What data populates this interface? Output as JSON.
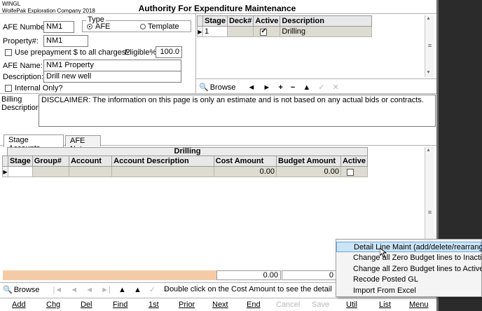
{
  "company": {
    "code": "WINGL",
    "name": "WolfePak Exploration Company 2018"
  },
  "window": {
    "title": "Authority For Expenditure Maintenance"
  },
  "form": {
    "afe_number_label": "AFE Number:",
    "afe_number": "NM1",
    "type_label": "Type",
    "type_afe": "AFE",
    "type_template": "Template",
    "type_selected": "AFE",
    "property_label": "Property#:",
    "property": "NM1",
    "prepayment_label": "Use prepayment $ to all charges?",
    "eligible_label": "Eligible%:",
    "eligible": "100.0",
    "afe_name_label": "AFE Name:",
    "afe_name": "NM1 Property",
    "description_label": "Description:",
    "description": "Drill new well",
    "internal_only_label": "Internal Only?",
    "billing_label_1": "Billing",
    "billing_label_2": "Description:",
    "billing_text": "DISCLAIMER:  The information on this page is only an estimate and is not based on any actual bids or contracts."
  },
  "stage_grid": {
    "columns": [
      "Stage",
      "Deck#",
      "Active",
      "Description"
    ],
    "rows": [
      {
        "stage": "1",
        "deck": "",
        "active": true,
        "description": "Drilling"
      }
    ]
  },
  "stage_nav": {
    "browse": "Browse",
    "icons": [
      "◄",
      "►",
      "+",
      "−",
      "▲",
      "✓",
      "✕"
    ]
  },
  "tabs": [
    {
      "label": "Stage Accounts",
      "active": true
    },
    {
      "label": "AFE Notes",
      "active": false
    }
  ],
  "accounts_grid": {
    "group_header": "Drilling",
    "columns": [
      "Stage",
      "Group#",
      "Account",
      "Account Description",
      "Cost Amount",
      "Budget Amount",
      "Active"
    ],
    "rows": [
      {
        "stage": "",
        "group": "",
        "account": "",
        "account_description": "",
        "cost_amount": "0.00",
        "budget_amount": "0.00",
        "active": false
      }
    ]
  },
  "totals": {
    "cost": "0.00",
    "budget": "0"
  },
  "bottom_nav": {
    "browse": "Browse",
    "icons": [
      "|◄",
      "◄",
      "◄",
      "►|",
      "▲",
      "▲",
      "✓",
      "✕"
    ],
    "hint": "Double click on the Cost Amount to see the detail"
  },
  "buttons": [
    {
      "label": "Add",
      "enabled": true
    },
    {
      "label": "Chg",
      "enabled": true
    },
    {
      "label": "Del",
      "enabled": true
    },
    {
      "label": "Find",
      "enabled": true
    },
    {
      "label": "1st",
      "enabled": true
    },
    {
      "label": "Prior",
      "enabled": true
    },
    {
      "label": "Next",
      "enabled": true
    },
    {
      "label": "End",
      "enabled": true
    },
    {
      "label": "Cancel",
      "enabled": false
    },
    {
      "label": "Save",
      "enabled": false
    },
    {
      "label": "Util",
      "enabled": true
    },
    {
      "label": "List",
      "enabled": true
    },
    {
      "label": "Menu",
      "enabled": true
    }
  ],
  "context_menu": {
    "items": [
      "Detail Line Maint (add/delete/rearrange)",
      "Change all Zero Budget lines to Inactive",
      "Change all Zero Budget lines to Active",
      "Recode Posted GL",
      "Import From Excel"
    ],
    "highlighted_index": 0
  }
}
